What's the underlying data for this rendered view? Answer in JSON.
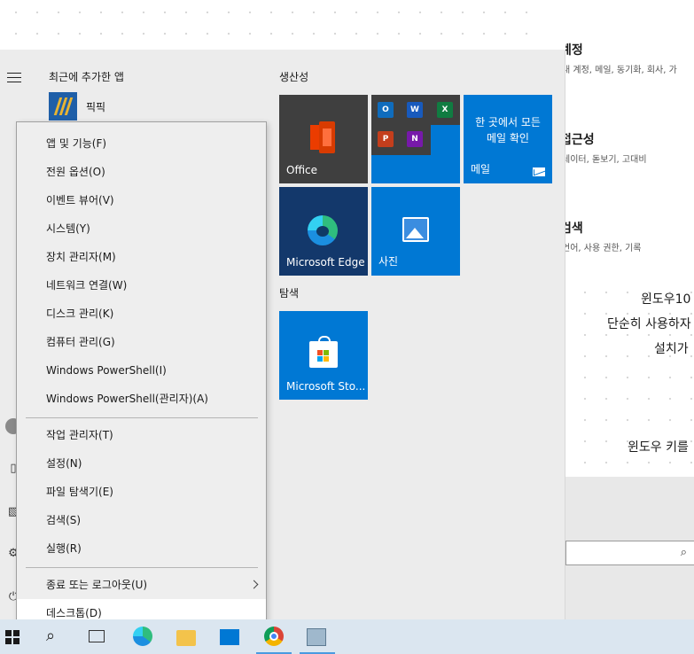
{
  "background": {
    "categories": [
      {
        "title": "계정",
        "subtitle": "내 계정, 메일, 동기화, 회사, 가"
      },
      {
        "title": "접근성",
        "subtitle": "레이터, 돋보기, 고대비"
      },
      {
        "title": "검색",
        "subtitle": "언어, 사용 권한, 기록"
      }
    ],
    "panel_lines": [
      "윈도우10",
      "단순히 사용하자",
      "설치가",
      "윈도우 키를"
    ]
  },
  "start_menu": {
    "recent_header": "최근에 추가한 앱",
    "recent_app": "픽픽",
    "productivity_header": "생산성",
    "explore_header": "탐색",
    "tiles": {
      "office": "Office",
      "mail_text": "한 곳에서 모든 메일 확인",
      "mail_label": "메일",
      "edge": "Microsoft Edge",
      "photos": "사진",
      "store": "Microsoft Sto..."
    },
    "office_mini_apps": [
      {
        "icon": "outlook-icon",
        "letter": "O",
        "color": "#0f6cbd"
      },
      {
        "icon": "word-icon",
        "letter": "W",
        "color": "#185abd"
      },
      {
        "icon": "excel-icon",
        "letter": "X",
        "color": "#107c41"
      },
      {
        "icon": "powerpoint-icon",
        "letter": "P",
        "color": "#c43e1c"
      },
      {
        "icon": "onenote-icon",
        "letter": "N",
        "color": "#7719aa"
      }
    ]
  },
  "context_menu": {
    "group1": [
      "앱 및 기능(F)",
      "전원 옵션(O)",
      "이벤트 뷰어(V)",
      "시스템(Y)",
      "장치 관리자(M)",
      "네트워크 연결(W)",
      "디스크 관리(K)",
      "컴퓨터 관리(G)",
      "Windows PowerShell(I)",
      "Windows PowerShell(관리자)(A)"
    ],
    "group2": [
      "작업 관리자(T)",
      "설정(N)",
      "파일 탐색기(E)",
      "검색(S)",
      "실행(R)"
    ],
    "shutdown": "종료 또는 로그아웃(U)",
    "desktop": "데스크톱(D)"
  },
  "colors": {
    "tile_blue": "#0078d4",
    "tile_dark": "#3f3f3f",
    "tile_edge": "#13386b",
    "taskbar": "#dbe6f0"
  }
}
